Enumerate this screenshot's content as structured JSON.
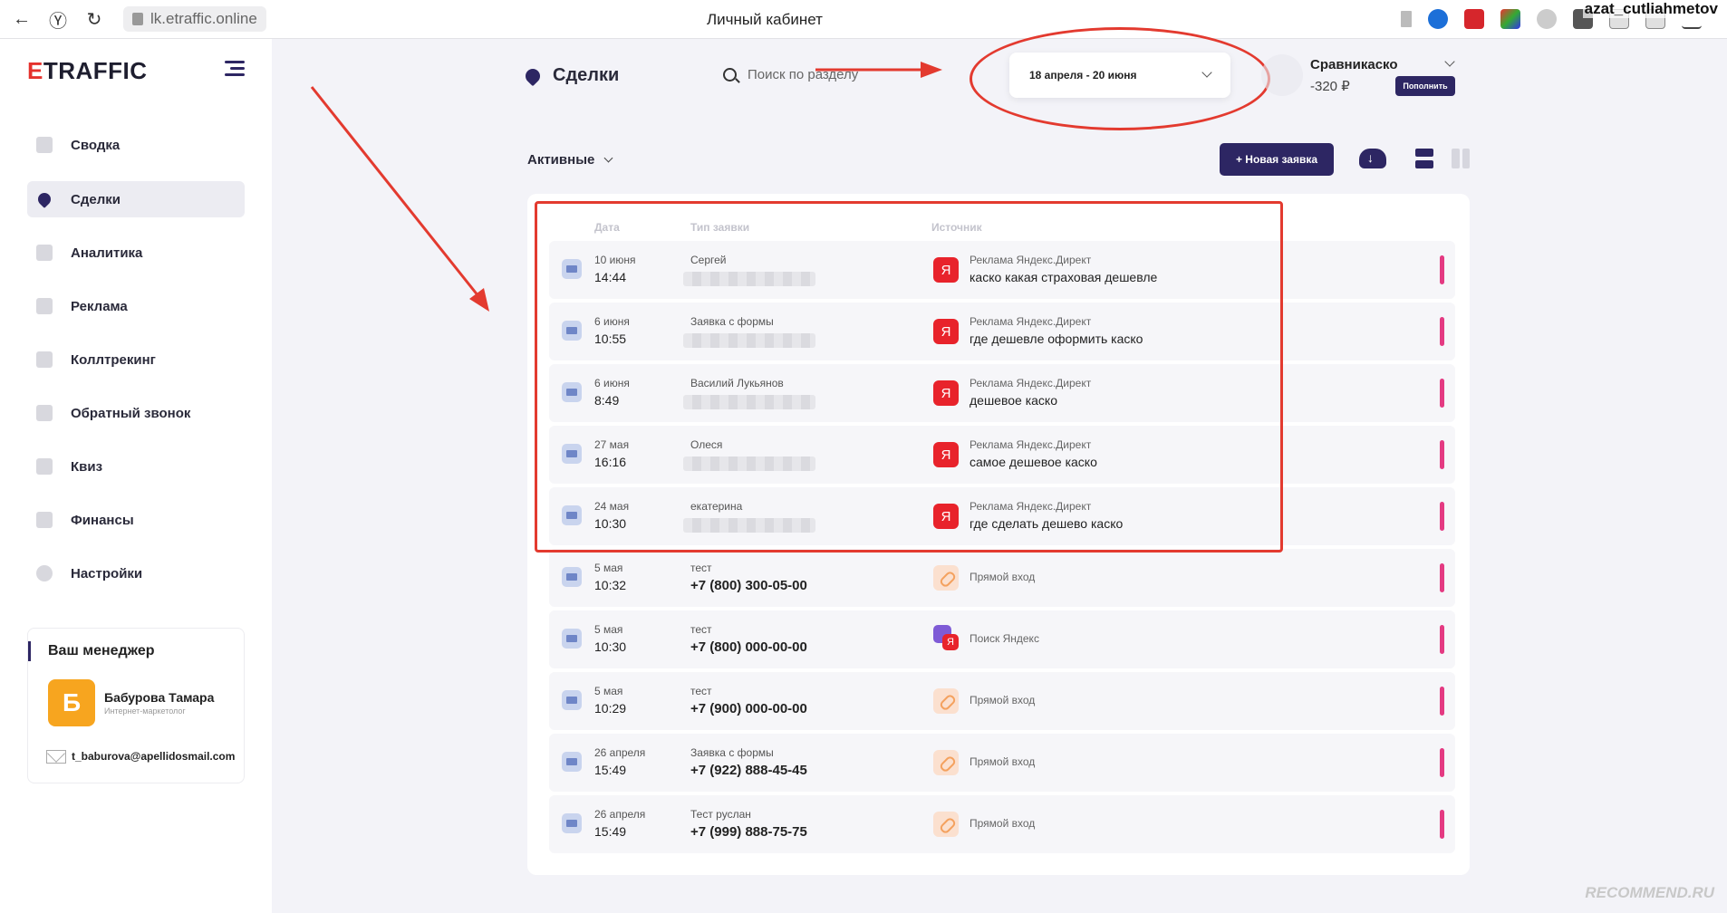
{
  "browser": {
    "url": "lk.etraffic.online",
    "title": "Личный кабинет",
    "overlay_user": "azat_cutliahmetov"
  },
  "sidebar": {
    "logo_prefix": "E",
    "logo_rest": "TRAFFIC",
    "items": [
      {
        "label": "Сводка",
        "icon": "dashboard-icon"
      },
      {
        "label": "Сделки",
        "icon": "deals-icon",
        "active": true
      },
      {
        "label": "Аналитика",
        "icon": "analytics-icon"
      },
      {
        "label": "Реклама",
        "icon": "ads-icon"
      },
      {
        "label": "Коллтрекинг",
        "icon": "calltracking-icon"
      },
      {
        "label": "Обратный звонок",
        "icon": "callback-icon"
      },
      {
        "label": "Квиз",
        "icon": "quiz-icon"
      },
      {
        "label": "Финансы",
        "icon": "finance-icon"
      },
      {
        "label": "Настройки",
        "icon": "settings-icon"
      }
    ],
    "manager": {
      "title": "Ваш менеджер",
      "avatar_letter": "Б",
      "name": "Бабурова Тамара",
      "role": "Интернет-маркетолог",
      "email": "t_baburova@apellidosmail.com"
    }
  },
  "header": {
    "title": "Сделки",
    "search_placeholder": "Поиск по разделу",
    "date_range": "18 апреля - 20 июня",
    "account_name": "Сравникаско",
    "balance": "-320 ₽",
    "topup_label": "Пополнить"
  },
  "toolbar": {
    "filter_label": "Активные",
    "new_button": "+ Новая заявка"
  },
  "table": {
    "headers": {
      "date": "Дата",
      "type": "Тип заявки",
      "source": "Источник"
    },
    "rows": [
      {
        "date": "10 июня",
        "time": "14:44",
        "type": "Сергей",
        "phone": "",
        "source_kind": "yandex",
        "source": "Реклама Яндекс.Директ",
        "query": "каско какая страховая дешевле"
      },
      {
        "date": "6 июня",
        "time": "10:55",
        "type": "Заявка с формы",
        "phone": "",
        "source_kind": "yandex",
        "source": "Реклама Яндекс.Директ",
        "query": "где дешевле оформить каско"
      },
      {
        "date": "6 июня",
        "time": "8:49",
        "type": "Василий Лукьянов",
        "phone": "",
        "source_kind": "yandex",
        "source": "Реклама Яндекс.Директ",
        "query": "дешевое каско"
      },
      {
        "date": "27 мая",
        "time": "16:16",
        "type": "Олеся",
        "phone": "",
        "source_kind": "yandex",
        "source": "Реклама Яндекс.Директ",
        "query": "самое дешевое каско"
      },
      {
        "date": "24 мая",
        "time": "10:30",
        "type": "екатерина",
        "phone": "",
        "source_kind": "yandex",
        "source": "Реклама Яндекс.Директ",
        "query": "где сделать дешево каско"
      },
      {
        "date": "5 мая",
        "time": "10:32",
        "type": "тест",
        "phone": "+7 (800) 300-05-00",
        "source_kind": "direct",
        "source": "Прямой вход",
        "query": ""
      },
      {
        "date": "5 мая",
        "time": "10:30",
        "type": "тест",
        "phone": "+7 (800) 000-00-00",
        "source_kind": "search",
        "source": "Поиск Яндекс",
        "query": ""
      },
      {
        "date": "5 мая",
        "time": "10:29",
        "type": "тест",
        "phone": "+7 (900) 000-00-00",
        "source_kind": "direct",
        "source": "Прямой вход",
        "query": ""
      },
      {
        "date": "26 апреля",
        "time": "15:49",
        "type": "Заявка с формы",
        "phone": "+7 (922) 888-45-45",
        "source_kind": "direct",
        "source": "Прямой вход",
        "query": ""
      },
      {
        "date": "26 апреля",
        "time": "15:49",
        "type": "Тест руслан",
        "phone": "+7 (999) 888-75-75",
        "source_kind": "direct",
        "source": "Прямой вход",
        "query": ""
      }
    ]
  },
  "yandex_glyph": "Я",
  "watermark": "RECOMMEND.RU",
  "colors": {
    "brand": "#2d2663",
    "annotation": "#e33a2f",
    "status": "#e43a82"
  }
}
